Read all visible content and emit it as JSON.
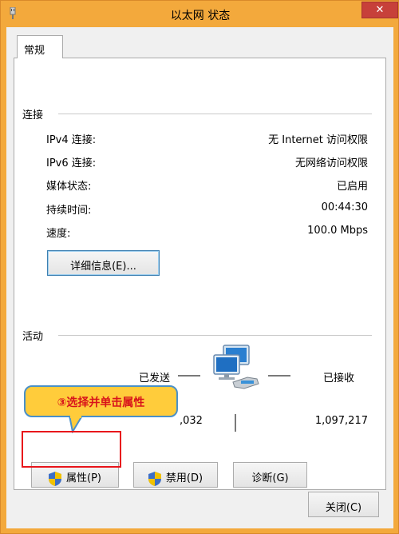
{
  "window": {
    "title": "以太网 状态",
    "close_label": "✕"
  },
  "tab": {
    "label": "常规"
  },
  "connection": {
    "header": "连接",
    "rows": [
      {
        "label": "IPv4 连接:",
        "value": "无 Internet 访问权限"
      },
      {
        "label": "IPv6 连接:",
        "value": "无网络访问权限"
      },
      {
        "label": "媒体状态:",
        "value": "已启用"
      },
      {
        "label": "持续时间:",
        "value": "00:44:30"
      },
      {
        "label": "速度:",
        "value": "100.0 Mbps"
      }
    ],
    "details_button": "详细信息(E)..."
  },
  "activity": {
    "header": "活动",
    "sent_label": "已发送",
    "received_label": "已接收",
    "sent_value": ",032",
    "received_value": "1,097,217"
  },
  "callout": {
    "text": "③选择并单击属性"
  },
  "buttons": {
    "properties": "属性(P)",
    "disable": "禁用(D)",
    "diagnose": "诊断(G)",
    "close": "关闭(C)"
  },
  "colors": {
    "frame": "#f3a93c",
    "callout_bg": "#ffcc3b",
    "callout_text": "#d8131b",
    "highlight": "#e8151b"
  },
  "icons": [
    "network-adapter-icon",
    "shield-icon",
    "network-computers-icon"
  ]
}
